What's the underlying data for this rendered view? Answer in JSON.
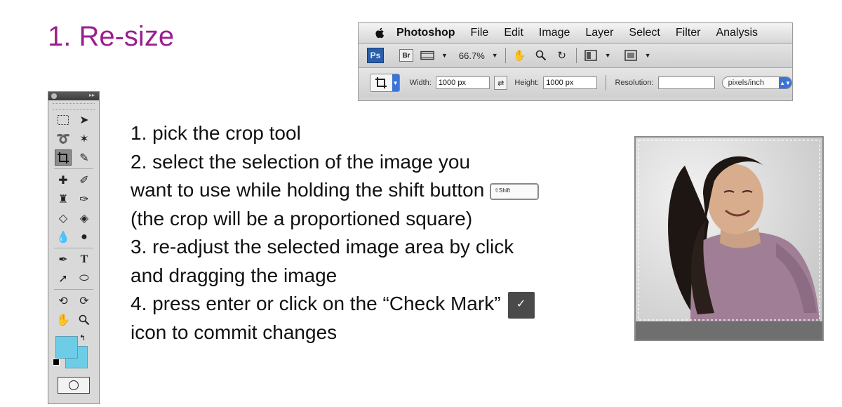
{
  "title": "1. Re-size",
  "menubar": {
    "app": "Photoshop",
    "items": [
      "File",
      "Edit",
      "Image",
      "Layer",
      "Select",
      "Filter",
      "Analysis"
    ]
  },
  "appbar": {
    "ps_logo": "Ps",
    "br_logo": "Br",
    "zoom": "66.7%"
  },
  "options": {
    "width_label": "Width:",
    "width_value": "1000 px",
    "height_label": "Height:",
    "height_value": "1000 px",
    "resolution_label": "Resolution:",
    "resolution_value": "",
    "units": "pixels/inch"
  },
  "steps": {
    "s1": "1. pick the crop tool",
    "s2a": "2. select the selection of the image you",
    "s2b": "want to use while holding the shift button",
    "s2c": "(the crop will be a proportioned square)",
    "s3a": "3. re-adjust the selected image area by click",
    "s3b": "and dragging the image",
    "s4a": "4. press enter or click on the “Check Mark”",
    "s4b": "icon to commit changes"
  },
  "shift_key_label": "⇧Shift",
  "check_icon": "✓",
  "colors": {
    "title": "#9b1f8e",
    "swatch": "#6dcde6",
    "sweater": "#a07f96"
  }
}
